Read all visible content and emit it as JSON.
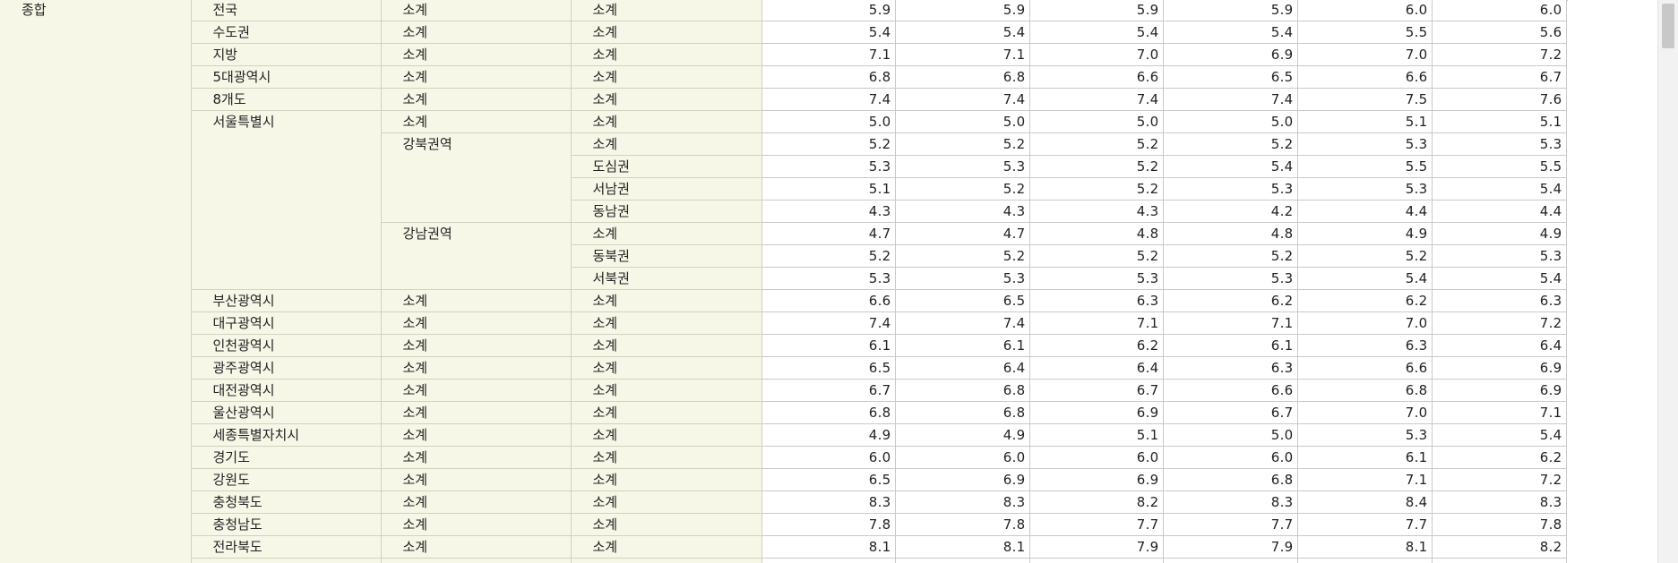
{
  "table": {
    "category": "종합",
    "rows": [
      {
        "region": "전국",
        "sub1": "소계",
        "sub2": "소계",
        "values": [
          "5.9",
          "5.9",
          "5.9",
          "5.9",
          "6.0",
          "6.0"
        ]
      },
      {
        "region": "수도권",
        "sub1": "소계",
        "sub2": "소계",
        "values": [
          "5.4",
          "5.4",
          "5.4",
          "5.4",
          "5.5",
          "5.6"
        ]
      },
      {
        "region": "지방",
        "sub1": "소계",
        "sub2": "소계",
        "values": [
          "7.1",
          "7.1",
          "7.0",
          "6.9",
          "7.0",
          "7.2"
        ]
      },
      {
        "region": "5대광역시",
        "sub1": "소계",
        "sub2": "소계",
        "values": [
          "6.8",
          "6.8",
          "6.6",
          "6.5",
          "6.6",
          "6.7"
        ]
      },
      {
        "region": "8개도",
        "sub1": "소계",
        "sub2": "소계",
        "values": [
          "7.4",
          "7.4",
          "7.4",
          "7.4",
          "7.5",
          "7.6"
        ]
      },
      {
        "region": "서울특별시",
        "sub1": "소계",
        "sub2": "소계",
        "values": [
          "5.0",
          "5.0",
          "5.0",
          "5.0",
          "5.1",
          "5.1"
        ]
      },
      {
        "region": "",
        "sub1": "강북권역",
        "sub2": "소계",
        "values": [
          "5.2",
          "5.2",
          "5.2",
          "5.2",
          "5.3",
          "5.3"
        ]
      },
      {
        "region": "",
        "sub1": "",
        "sub2": "도심권",
        "values": [
          "5.3",
          "5.3",
          "5.2",
          "5.4",
          "5.5",
          "5.5"
        ]
      },
      {
        "region": "",
        "sub1": "",
        "sub2": "서남권",
        "values": [
          "5.1",
          "5.2",
          "5.2",
          "5.3",
          "5.3",
          "5.4"
        ]
      },
      {
        "region": "",
        "sub1": "",
        "sub2": "동남권",
        "values": [
          "4.3",
          "4.3",
          "4.3",
          "4.2",
          "4.4",
          "4.4"
        ]
      },
      {
        "region": "",
        "sub1": "강남권역",
        "sub2": "소계",
        "values": [
          "4.7",
          "4.7",
          "4.8",
          "4.8",
          "4.9",
          "4.9"
        ]
      },
      {
        "region": "",
        "sub1": "",
        "sub2": "동북권",
        "values": [
          "5.2",
          "5.2",
          "5.2",
          "5.2",
          "5.2",
          "5.3"
        ]
      },
      {
        "region": "",
        "sub1": "",
        "sub2": "서북권",
        "values": [
          "5.3",
          "5.3",
          "5.3",
          "5.3",
          "5.4",
          "5.4"
        ]
      },
      {
        "region": "부산광역시",
        "sub1": "소계",
        "sub2": "소계",
        "values": [
          "6.6",
          "6.5",
          "6.3",
          "6.2",
          "6.2",
          "6.3"
        ]
      },
      {
        "region": "대구광역시",
        "sub1": "소계",
        "sub2": "소계",
        "values": [
          "7.4",
          "7.4",
          "7.1",
          "7.1",
          "7.0",
          "7.2"
        ]
      },
      {
        "region": "인천광역시",
        "sub1": "소계",
        "sub2": "소계",
        "values": [
          "6.1",
          "6.1",
          "6.2",
          "6.1",
          "6.3",
          "6.4"
        ]
      },
      {
        "region": "광주광역시",
        "sub1": "소계",
        "sub2": "소계",
        "values": [
          "6.5",
          "6.4",
          "6.4",
          "6.3",
          "6.6",
          "6.9"
        ]
      },
      {
        "region": "대전광역시",
        "sub1": "소계",
        "sub2": "소계",
        "values": [
          "6.7",
          "6.8",
          "6.7",
          "6.6",
          "6.8",
          "6.9"
        ]
      },
      {
        "region": "울산광역시",
        "sub1": "소계",
        "sub2": "소계",
        "values": [
          "6.8",
          "6.8",
          "6.9",
          "6.7",
          "7.0",
          "7.1"
        ]
      },
      {
        "region": "세종특별자치시",
        "sub1": "소계",
        "sub2": "소계",
        "values": [
          "4.9",
          "4.9",
          "5.1",
          "5.0",
          "5.3",
          "5.4"
        ]
      },
      {
        "region": "경기도",
        "sub1": "소계",
        "sub2": "소계",
        "values": [
          "6.0",
          "6.0",
          "6.0",
          "6.0",
          "6.1",
          "6.2"
        ]
      },
      {
        "region": "강원도",
        "sub1": "소계",
        "sub2": "소계",
        "values": [
          "6.5",
          "6.9",
          "6.9",
          "6.8",
          "7.1",
          "7.2"
        ]
      },
      {
        "region": "충청북도",
        "sub1": "소계",
        "sub2": "소계",
        "values": [
          "8.3",
          "8.3",
          "8.2",
          "8.3",
          "8.4",
          "8.3"
        ]
      },
      {
        "region": "충청남도",
        "sub1": "소계",
        "sub2": "소계",
        "values": [
          "7.8",
          "7.8",
          "7.7",
          "7.7",
          "7.7",
          "7.8"
        ]
      },
      {
        "region": "전라북도",
        "sub1": "소계",
        "sub2": "소계",
        "values": [
          "8.1",
          "8.1",
          "7.9",
          "7.9",
          "8.1",
          "8.2"
        ]
      }
    ]
  },
  "colors": {
    "header_bg": "#f7f7e8",
    "grid_line": "#c9c9c9",
    "scrollbar_thumb": "#c8c8c8"
  }
}
